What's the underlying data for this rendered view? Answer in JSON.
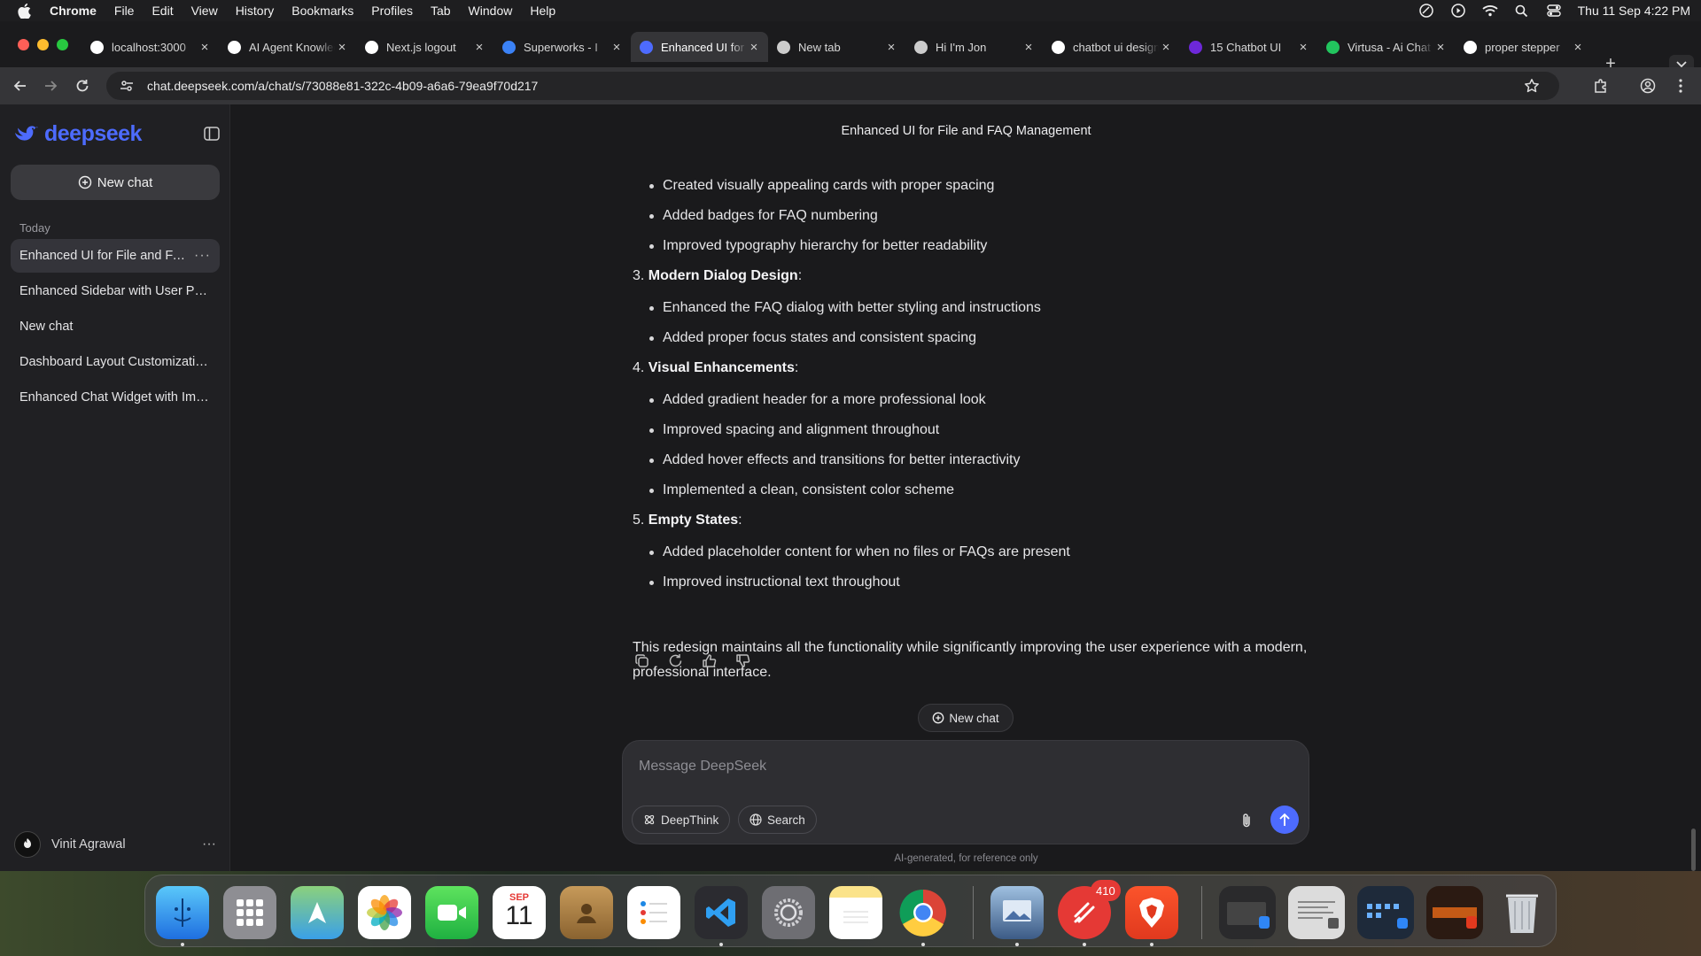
{
  "menubar": {
    "app_name": "Chrome",
    "items": [
      "File",
      "Edit",
      "View",
      "History",
      "Bookmarks",
      "Profiles",
      "Tab",
      "Window",
      "Help"
    ],
    "clock": "Thu 11 Sep  4:22 PM"
  },
  "tabs": [
    {
      "title": "localhost:3000",
      "icon": "vercel-triangle-icon",
      "color": "#ffffff"
    },
    {
      "title": "AI Agent Knowledge",
      "icon": "openai-icon",
      "color": "#ffffff"
    },
    {
      "title": "Next.js logout",
      "icon": "chatgpt-icon",
      "color": "#ffffff"
    },
    {
      "title": "Superworks - I",
      "icon": "superworks-icon",
      "color": "#3b82f6"
    },
    {
      "title": "Enhanced UI for",
      "icon": "deepseek-icon",
      "color": "#4d6bfe"
    },
    {
      "title": "New tab",
      "icon": "chrome-icon",
      "color": "#cccccc"
    },
    {
      "title": "Hi I'm Jon",
      "icon": "globe-icon",
      "color": "#cccccc"
    },
    {
      "title": "chatbot ui design",
      "icon": "google-icon",
      "color": "#ffffff"
    },
    {
      "title": "15 Chatbot UI",
      "icon": "site-purple-icon",
      "color": "#6d28d9"
    },
    {
      "title": "Virtusa - Ai Chat",
      "icon": "site-green-icon",
      "color": "#22c55e"
    },
    {
      "title": "proper stepper",
      "icon": "google-icon",
      "color": "#ffffff"
    }
  ],
  "address": {
    "url": "chat.deepseek.com/a/chat/s/73088e81-322c-4b09-a6a6-79ea9f70d217"
  },
  "sidebar": {
    "logo_text": "deepseek",
    "new_chat_label": "New chat",
    "section_label": "Today",
    "items": [
      "Enhanced UI for File and FAQ",
      "Enhanced Sidebar with User Pro...",
      "New chat",
      "Dashboard Layout Customizatio...",
      "Enhanced Chat Widget with Imp..."
    ],
    "user_name": "Vinit Agrawal"
  },
  "chat": {
    "title": "Enhanced UI for File and FAQ Management",
    "lead_bullets": [
      "Created visually appealing cards with proper spacing",
      "Added badges for FAQ numbering",
      "Improved typography hierarchy for better readability"
    ],
    "sections": [
      {
        "number": "3.",
        "heading": "Modern Dialog Design",
        "bullets": [
          "Enhanced the FAQ dialog with better styling and instructions",
          "Added proper focus states and consistent spacing"
        ]
      },
      {
        "number": "4.",
        "heading": "Visual Enhancements",
        "bullets": [
          "Added gradient header for a more professional look",
          "Improved spacing and alignment throughout",
          "Added hover effects and transitions for better interactivity",
          "Implemented a clean, consistent color scheme"
        ]
      },
      {
        "number": "5.",
        "heading": "Empty States",
        "bullets": [
          "Added placeholder content for when no files or FAQs are present",
          "Improved instructional text throughout"
        ]
      }
    ],
    "summary": "This redesign maintains all the functionality while significantly improving the user experience with a modern, professional interface.",
    "new_chat_pill": "New chat"
  },
  "composer": {
    "placeholder": "Message DeepSeek",
    "deepthink_label": "DeepThink",
    "search_label": "Search",
    "disclaimer": "AI-generated, for reference only"
  },
  "dock": {
    "calendar_month": "SEP",
    "calendar_day": "11",
    "notification_badge": "410"
  },
  "colors": {
    "accent": "#4d6bfe",
    "sidebar_bg": "#202023",
    "main_bg": "#1a1a1c"
  }
}
